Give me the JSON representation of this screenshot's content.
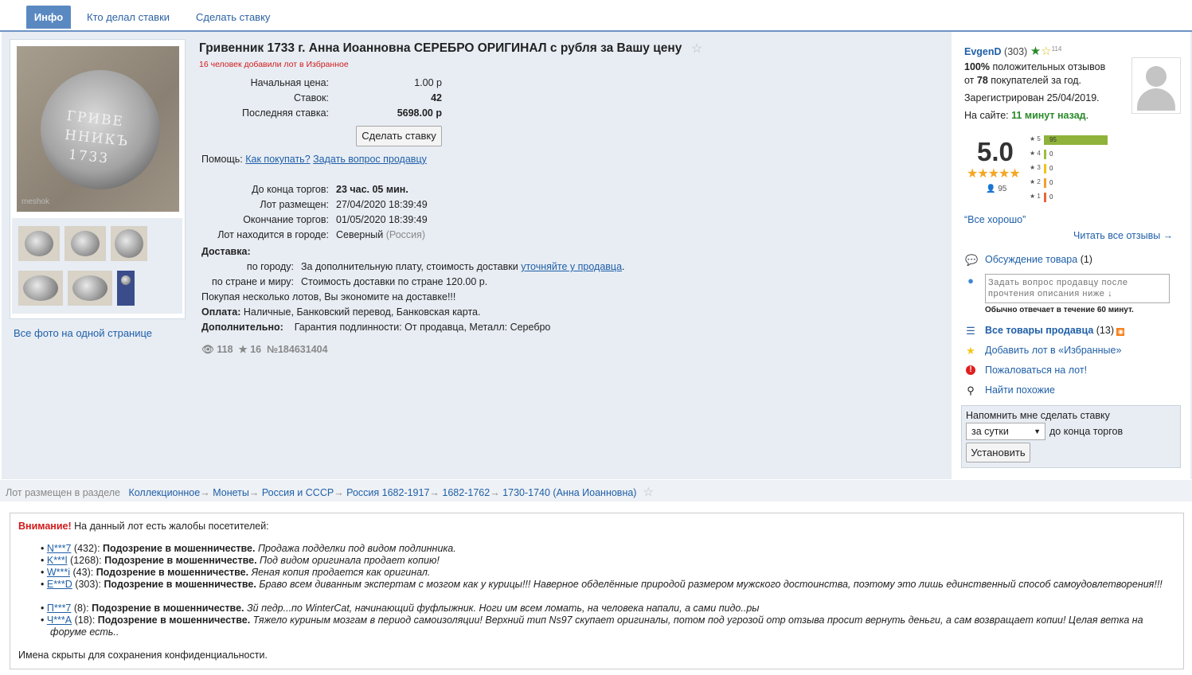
{
  "tabs": {
    "info": "Инфо",
    "who_bid": "Кто делал ставки",
    "make_bid": "Сделать ставку"
  },
  "photos": {
    "all_link": "Все фото на одной странице",
    "watermark": "meshok"
  },
  "lot": {
    "title": "Гривенник 1733 г. Анна Иоанновна СЕРЕБРО ОРИГИНАЛ с рубля за Вашу цену",
    "favorites_note": "16 человек добавили лот в Избранное",
    "start_price_label": "Начальная цена:",
    "start_price": "1.00 р",
    "bids_label": "Ставок:",
    "bids": "42",
    "last_bid_label": "Последняя ставка:",
    "last_bid": "5698.00 р",
    "bid_button": "Сделать ставку",
    "help_label": "Помощь:",
    "help_how": "Как покупать?",
    "help_ask": "Задать вопрос продавцу",
    "ends_in_label": "До конца торгов:",
    "ends_in": "23 час. 05 мин.",
    "placed_label": "Лот размещен:",
    "placed": "27/04/2020 18:39:49",
    "end_label": "Окончание торгов:",
    "end": "01/05/2020 18:39:49",
    "city_label": "Лот находится в городе:",
    "city": "Северный",
    "country": "(Россия)",
    "delivery_label": "Доставка:",
    "city_delivery_label": "по городу:",
    "city_delivery": "За дополнительную плату, стоимость доставки",
    "city_delivery_link": "уточняйте у продавца",
    "world_delivery_label": "по стране и миру:",
    "world_delivery": "Стоимость доставки по стране 120.00 р.",
    "save_note": "Покупая несколько лотов, Вы экономите на доставке!!!",
    "payment_label": "Оплата:",
    "payment": "Наличные, Банковский перевод, Банковская карта.",
    "extra_label": "Дополнительно:",
    "extra": "Гарантия подлинности: От продавца, Металл: Серебро",
    "views": "118",
    "stars": "16",
    "lot_id": "№184631404"
  },
  "seller": {
    "name": "EvgenD",
    "rating": "(303)",
    "star_count": "114",
    "positive_pct": "100%",
    "positive_text": "положительных отзывов",
    "from_label": "от",
    "buyers": "78",
    "buyers_text": "покупателей за год.",
    "registered": "Зарегистрирован 25/04/2019.",
    "online_label": "На сайте:",
    "online": "11 минут назад",
    "score": "5.0",
    "reviews_count": "95",
    "bars": [
      {
        "label": "5",
        "value": "95",
        "fraction": 1.0,
        "color": "#8fb33a"
      },
      {
        "label": "4",
        "value": "0",
        "fraction": 0,
        "color": "#9cbf3d"
      },
      {
        "label": "3",
        "value": "0",
        "fraction": 0,
        "color": "#f0c419"
      },
      {
        "label": "2",
        "value": "0",
        "fraction": 0,
        "color": "#f0a030"
      },
      {
        "label": "1",
        "value": "0",
        "fraction": 0,
        "color": "#e8663a"
      }
    ],
    "quote": "“Все хорошо”",
    "read_all": "Читать все отзывы →",
    "discussion": "Обсуждение товара",
    "discussion_count": "(1)",
    "ask_placeholder": "Задать вопрос продавцу после прочтения описания ниже ↓",
    "reply_note": "Обычно отвечает в течение 60 минут.",
    "all_goods": "Все товары продавца",
    "all_goods_count": "(13)",
    "add_fav": "Добавить лот в «Избранные»",
    "complain": "Пожаловаться на лот!",
    "find_similar": "Найти похожие",
    "remind_label": "Напомнить мне сделать ставку",
    "remind_select": "за сутки",
    "remind_suffix": "до конца торгов",
    "remind_button": "Установить"
  },
  "breadcrumb": {
    "label": "Лот размещен в разделе",
    "items": [
      "Коллекционное",
      "Монеты",
      "Россия и СССР",
      "Россия 1682-1917",
      "1682-1762",
      "1730-1740 (Анна Иоанновна)"
    ],
    "arrow": "→"
  },
  "warning": {
    "title": "Внимание!",
    "text": "На данный лот есть жалобы посетителей:",
    "items": [
      {
        "user": "N***7",
        "rating": "(432):",
        "reason": "Подозрение в мошенничестве.",
        "comment": "Продажа подделки под видом подлинника."
      },
      {
        "user": "K***l",
        "rating": "(1268):",
        "reason": "Подозрение в мошенничестве.",
        "comment": "Под видом оригинала продает копию!"
      },
      {
        "user": "W***i",
        "rating": "(43):",
        "reason": "Подозрение в мошенничестве.",
        "comment": "Яеная копия продается как оригинал."
      },
      {
        "user": "E***D",
        "rating": "(303):",
        "reason": "Подозрение в мошенничестве.",
        "comment": "Браво всем диванным экспертам с мозгом как у курицы!!! Наверное обделённые природой размером мужского достоинства, поэтому это лишь единственный способ самоудовлетворения!!!"
      },
      {
        "user": "П***7",
        "rating": "(8):",
        "reason": "Подозрение в мошенничестве.",
        "comment": "Зй педр...по WinterCat, начинающий фуфлыжник. Ноги им всем ломать, на человека напали, а сами пидо..ры"
      },
      {
        "user": "Ч***А",
        "rating": "(18):",
        "reason": "Подозрение в мошенничестве.",
        "comment": "Тяжело куриным мозгам в период самоизоляции! Верхний тип Ns97 скупает оригиналы, потом под угрозой отр отзыва просит вернуть деньги, а сам возвращает копии! Целая ветка на форуме есть.."
      }
    ],
    "footer": "Имена скрыты для сохранения конфиденциальности."
  }
}
